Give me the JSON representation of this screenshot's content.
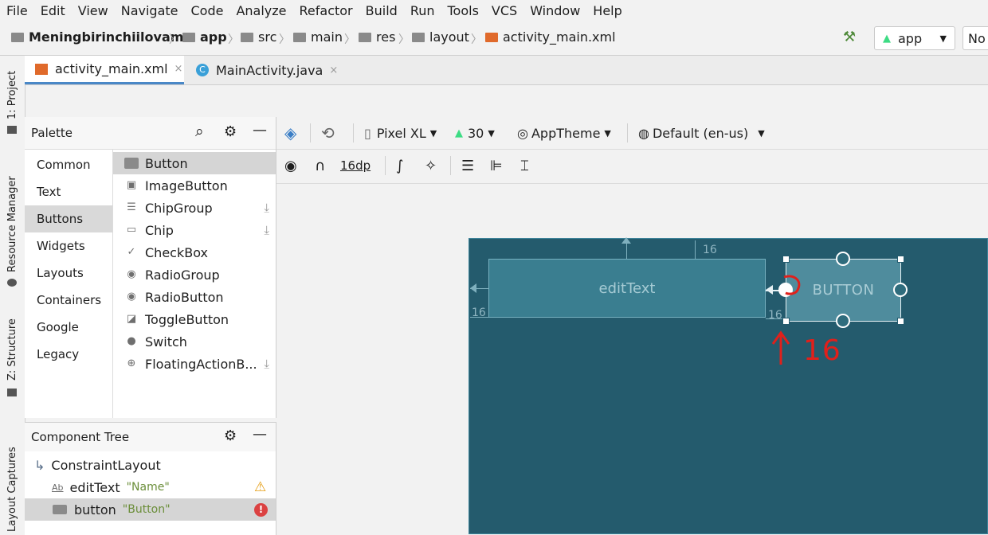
{
  "menu": [
    "File",
    "Edit",
    "View",
    "Navigate",
    "Code",
    "Analyze",
    "Refactor",
    "Build",
    "Run",
    "Tools",
    "VCS",
    "Window",
    "Help"
  ],
  "breadcrumb": [
    "Meningbirinchiilovam",
    "app",
    "src",
    "main",
    "res",
    "layout",
    "activity_main.xml"
  ],
  "run_config": {
    "label": "app",
    "device_label": "No"
  },
  "tabs": [
    {
      "label": "activity_main.xml",
      "close": "×"
    },
    {
      "label": "MainActivity.java",
      "close": "×"
    }
  ],
  "left_strip": [
    "1: Project",
    "Resource Manager",
    "Z: Structure",
    "Layout Captures"
  ],
  "palette": {
    "title": "Palette",
    "categories": [
      "Common",
      "Text",
      "Buttons",
      "Widgets",
      "Layouts",
      "Containers",
      "Google",
      "Legacy"
    ],
    "selected_category": "Buttons",
    "items": [
      "Button",
      "ImageButton",
      "ChipGroup",
      "Chip",
      "CheckBox",
      "RadioGroup",
      "RadioButton",
      "ToggleButton",
      "Switch",
      "FloatingActionB..."
    ]
  },
  "component_tree": {
    "title": "Component Tree",
    "root": "ConstraintLayout",
    "children": [
      {
        "name": "editText",
        "value": "\"Name\"",
        "status": "warning"
      },
      {
        "name": "button",
        "value": "\"Button\"",
        "status": "error"
      }
    ]
  },
  "toolbar": {
    "device": "Pixel XL",
    "api": "30",
    "theme": "AppTheme",
    "locale": "Default (en-us)",
    "margin": "16dp"
  },
  "canvas": {
    "edittext_label": "editText",
    "button_label": "BUTTON",
    "margin_top": "16",
    "margin_left": "16",
    "margin_button": "16",
    "annotation": "16"
  },
  "colors": {
    "blueprint": "#245b6d",
    "accent": "#4a88c7",
    "annotation": "#e0201b"
  }
}
